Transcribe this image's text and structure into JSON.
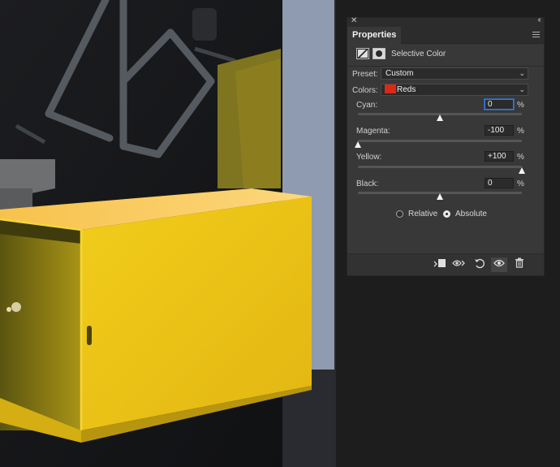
{
  "panel": {
    "tab_label": "Properties",
    "adjustment_title": "Selective Color",
    "preset": {
      "label": "Preset:",
      "value": "Custom"
    },
    "colors": {
      "label": "Colors:",
      "value": "Reds",
      "swatch_color": "#d92a16"
    },
    "sliders": [
      {
        "label": "Cyan:",
        "value": "0",
        "unit": "%",
        "level": 0
      },
      {
        "label": "Magenta:",
        "value": "-100",
        "unit": "%",
        "level": -100
      },
      {
        "label": "Yellow:",
        "value": "+100",
        "unit": "%",
        "level": 100
      },
      {
        "label": "Black:",
        "value": "0",
        "unit": "%",
        "level": 0
      }
    ],
    "method": {
      "options": [
        "Relative",
        "Absolute"
      ],
      "selected": "Absolute"
    },
    "footer_icons": [
      "clip-to-layer-icon",
      "view-previous-state-icon",
      "reset-icon",
      "visibility-eye-icon",
      "trash-icon"
    ]
  },
  "colors": {
    "panel_bg": "#383838",
    "app_bg": "#1d1d1d",
    "accent_focus": "#3a7bd5",
    "box_yellow": "#f2c418"
  }
}
